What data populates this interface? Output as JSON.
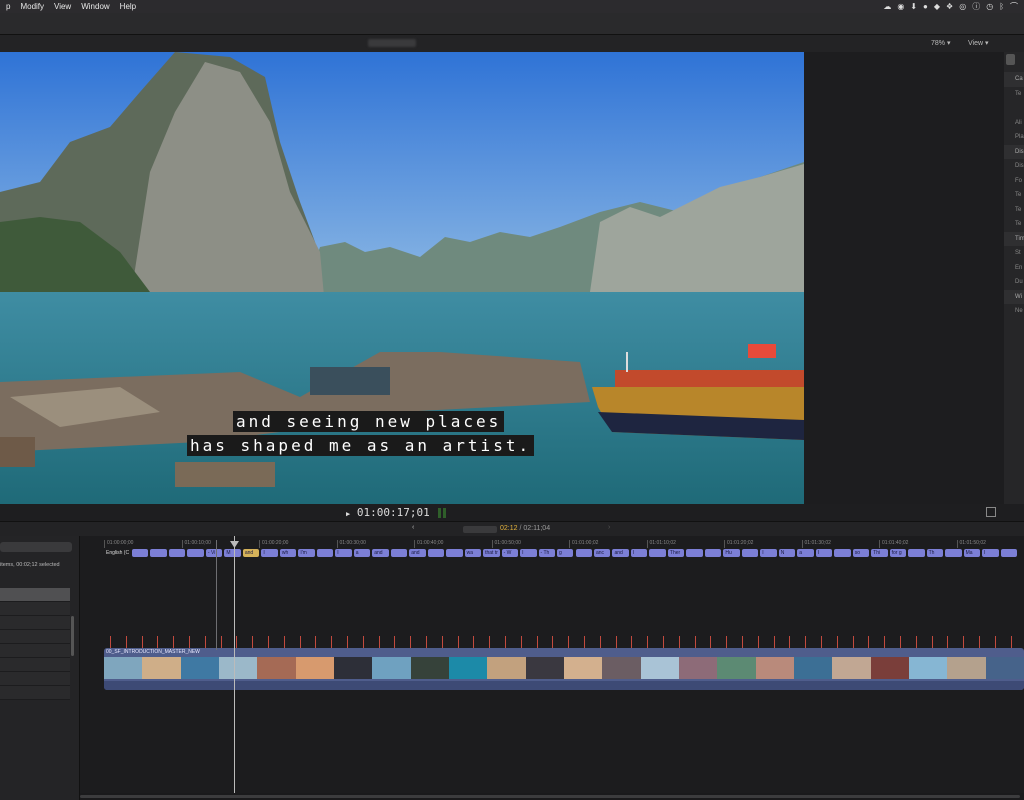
{
  "menubar": {
    "items": [
      "p",
      "Modify",
      "View",
      "Window",
      "Help"
    ]
  },
  "viewer": {
    "zoom_label": "78% ▾",
    "view_label": "View ▾",
    "subtitle_line1": "and seeing new places",
    "subtitle_line2": "has shaped me as an artist.",
    "timecode": "01:00:17;01",
    "timecode_prefix": "▶"
  },
  "inspector": {
    "rows": [
      "Ca",
      "Te",
      "",
      "Ali",
      "Pla",
      "Dis",
      "Dis",
      "Fo",
      "Te",
      "Te",
      "Te",
      "Tim",
      "St",
      "En",
      "Du",
      "Wi",
      "Ne"
    ]
  },
  "timeline": {
    "nav_left": "‹",
    "nav_right": "›",
    "duration_current": "02:12",
    "duration_total": " / 02:11;04",
    "index_count": "items, 00:02;12 selected",
    "lane_label": "English (C",
    "clip_name": "00_SF_INTRODUCTION_MASTER_NEW",
    "ruler_ticks": [
      "01:00:00;00",
      "01:00:10;00",
      "01:00:20;00",
      "01:00:30;00",
      "01:00:40;00",
      "01:00:50;00",
      "01:01:00;02",
      "01:01:10;02",
      "01:01:20;02",
      "01:01:30;02",
      "01:01:40;02",
      "01:01:50;02"
    ],
    "captions": [
      {
        "text": "",
        "sel": false
      },
      {
        "text": "",
        "sel": false
      },
      {
        "text": "",
        "sel": false
      },
      {
        "text": "",
        "sel": false
      },
      {
        "text": "- Vi",
        "sel": false
      },
      {
        "text": "M",
        "sel": false
      },
      {
        "text": "and",
        "sel": true
      },
      {
        "text": "I",
        "sel": false
      },
      {
        "text": "wh",
        "sel": false
      },
      {
        "text": "I'm",
        "sel": false
      },
      {
        "text": "",
        "sel": false
      },
      {
        "text": "I",
        "sel": false
      },
      {
        "text": "a",
        "sel": false
      },
      {
        "text": "and",
        "sel": false
      },
      {
        "text": "",
        "sel": false
      },
      {
        "text": "and",
        "sel": false
      },
      {
        "text": "",
        "sel": false
      },
      {
        "text": "",
        "sel": false
      },
      {
        "text": "wa",
        "sel": false
      },
      {
        "text": "that tr",
        "sel": false
      },
      {
        "text": "- W",
        "sel": false
      },
      {
        "text": "I",
        "sel": false
      },
      {
        "text": "- Th",
        "sel": false
      },
      {
        "text": "g",
        "sel": false
      },
      {
        "text": "",
        "sel": false
      },
      {
        "text": "anc",
        "sel": false
      },
      {
        "text": "and",
        "sel": false
      },
      {
        "text": "I",
        "sel": false
      },
      {
        "text": "",
        "sel": false
      },
      {
        "text": "Ther",
        "sel": false
      },
      {
        "text": "",
        "sel": false
      },
      {
        "text": "",
        "sel": false
      },
      {
        "text": "Hu",
        "sel": false
      },
      {
        "text": "",
        "sel": false
      },
      {
        "text": "I",
        "sel": false
      },
      {
        "text": "N",
        "sel": false
      },
      {
        "text": "a",
        "sel": false
      },
      {
        "text": "I",
        "sel": false
      },
      {
        "text": "",
        "sel": false
      },
      {
        "text": "so",
        "sel": false
      },
      {
        "text": "Thi",
        "sel": false
      },
      {
        "text": "for g",
        "sel": false
      },
      {
        "text": "",
        "sel": false
      },
      {
        "text": "Th",
        "sel": false
      },
      {
        "text": "",
        "sel": false
      },
      {
        "text": "Ma",
        "sel": false
      },
      {
        "text": "I",
        "sel": false
      },
      {
        "text": "",
        "sel": false
      }
    ],
    "thumbnail_colors": [
      "#7fa6be",
      "#cfae88",
      "#3f79a3",
      "#9bb8c9",
      "#a56a55",
      "#d79a6e",
      "#2d2f38",
      "#6fa1c0",
      "#36423a",
      "#1c8aa8",
      "#c2a17e",
      "#3a3840",
      "#d3b08e",
      "#6b5d63",
      "#a9c3d6",
      "#8d6b78",
      "#5c8a73",
      "#b98a7b",
      "#3c6f95",
      "#c1a793",
      "#7a3e3a",
      "#86b6d3",
      "#b4a18d",
      "#46638a"
    ]
  }
}
